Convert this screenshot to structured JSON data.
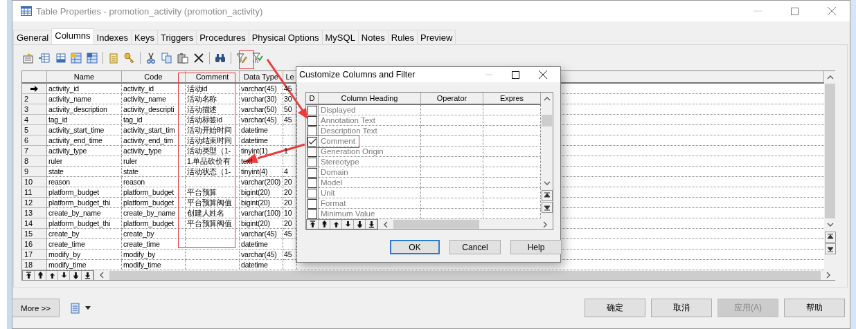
{
  "window": {
    "title": "Table Properties - promotion_activity (promotion_activity)"
  },
  "tabs": [
    {
      "label": "General",
      "selected": false
    },
    {
      "label": "Columns",
      "selected": true
    },
    {
      "label": "Indexes",
      "selected": false
    },
    {
      "label": "Keys",
      "selected": false
    },
    {
      "label": "Triggers",
      "selected": false
    },
    {
      "label": "Procedures",
      "selected": false
    },
    {
      "label": "Physical Options",
      "selected": false
    },
    {
      "label": "MySQL",
      "selected": false
    },
    {
      "label": "Notes",
      "selected": false
    },
    {
      "label": "Rules",
      "selected": false
    },
    {
      "label": "Preview",
      "selected": false
    }
  ],
  "table": {
    "columns": [
      "Name",
      "Code",
      "Comment",
      "Data Type",
      "Le"
    ],
    "rows": [
      {
        "current": true,
        "name": "activity_id",
        "code": "activity_id",
        "comment": "活动id",
        "data_type": "varchar(45)",
        "column_5": "45"
      },
      {
        "current": false,
        "number": "2",
        "name": "activity_name",
        "code": "activity_name",
        "comment": "活动名称",
        "data_type": "varchar(30)",
        "column_5": "30"
      },
      {
        "current": false,
        "number": "3",
        "name": "activity_description",
        "code": "activity_descripti",
        "comment": "活动描述",
        "data_type": "varchar(50)",
        "column_5": "50"
      },
      {
        "current": false,
        "number": "4",
        "name": "tag_id",
        "code": "tag_id",
        "comment": "活动标签id",
        "data_type": "varchar(45)",
        "column_5": "45"
      },
      {
        "current": false,
        "number": "5",
        "name": "activity_start_time",
        "code": "activity_start_tim",
        "comment": "活动开始时间",
        "data_type": "datetime"
      },
      {
        "current": false,
        "number": "6",
        "name": "activity_end_time",
        "code": "activity_end_tim",
        "comment": "活动结束时间",
        "data_type": "datetime"
      },
      {
        "current": false,
        "number": "7",
        "name": "activity_type",
        "code": "activity_type",
        "comment": "活动类型（1-",
        "data_type": "tinyint(1)",
        "column_5": "1"
      },
      {
        "current": false,
        "number": "8",
        "name": "ruler",
        "code": "ruler",
        "comment": "1.单品砍价有",
        "data_type": "text"
      },
      {
        "current": false,
        "number": "9",
        "name": "state",
        "code": "state",
        "comment": "活动状态（1-",
        "data_type": "tinyint(4)",
        "column_5": "4"
      },
      {
        "current": false,
        "number": "10",
        "name": "reason",
        "code": "reason",
        "data_type": "varchar(200)",
        "column_5": "20"
      },
      {
        "current": false,
        "number": "11",
        "name": "platform_budget",
        "code": "platform_budget",
        "comment": "平台预算",
        "data_type": "bigint(20)",
        "column_5": "20"
      },
      {
        "current": false,
        "number": "12",
        "name": "platform_budget_thi",
        "code": "platform_budget",
        "comment": "平台预算阀值",
        "data_type": "bigint(20)",
        "column_5": "20"
      },
      {
        "current": false,
        "number": "13",
        "name": "create_by_name",
        "code": "create_by_name",
        "comment": "创建人姓名",
        "data_type": "varchar(100)",
        "column_5": "10"
      },
      {
        "current": false,
        "number": "14",
        "name": "platform_budget_thi",
        "code": "platform_budget",
        "comment": "平台预算阀值",
        "data_type": "bigint(20)",
        "column_5": "20"
      },
      {
        "current": false,
        "number": "15",
        "name": "create_by",
        "code": "create_by",
        "data_type": "varchar(45)",
        "column_5": "45"
      },
      {
        "current": false,
        "number": "16",
        "name": "create_time",
        "code": "create_time",
        "data_type": "datetime"
      },
      {
        "current": false,
        "number": "17",
        "name": "modify_by",
        "code": "modify_by",
        "data_type": "varchar(45)",
        "column_5": "45"
      },
      {
        "current": false,
        "number": "18",
        "name": "modify_time",
        "code": "modify_time",
        "data_type": "datetime"
      }
    ]
  },
  "dialog": {
    "title": "Customize Columns and Filter",
    "columns": [
      "D",
      "Column Heading",
      "Operator",
      "Expres"
    ],
    "rows": [
      {
        "label": "Displayed",
        "checked": false
      },
      {
        "label": "Annotation Text",
        "checked": false
      },
      {
        "label": "Description Text",
        "checked": false
      },
      {
        "label": "Comment",
        "checked": true
      },
      {
        "label": "Generation Origin",
        "checked": false
      },
      {
        "label": "Stereotype",
        "checked": false
      },
      {
        "label": "Domain",
        "checked": false
      },
      {
        "label": "Model",
        "checked": false
      },
      {
        "label": "Unit",
        "checked": false
      },
      {
        "label": "Format",
        "checked": false
      },
      {
        "label": "Minimum Value",
        "checked": false
      }
    ],
    "buttons": [
      {
        "label": "OK",
        "focused": true
      },
      {
        "label": "Cancel",
        "focused": false
      },
      {
        "label": "Help",
        "focused": false
      }
    ]
  },
  "footer": {
    "more_button": "More >>",
    "buttons": [
      {
        "label": "确定",
        "disabled": false
      },
      {
        "label": "取消",
        "disabled": false
      },
      {
        "label": "应用(A)",
        "disabled": true
      },
      {
        "label": "帮助",
        "disabled": false
      }
    ]
  }
}
